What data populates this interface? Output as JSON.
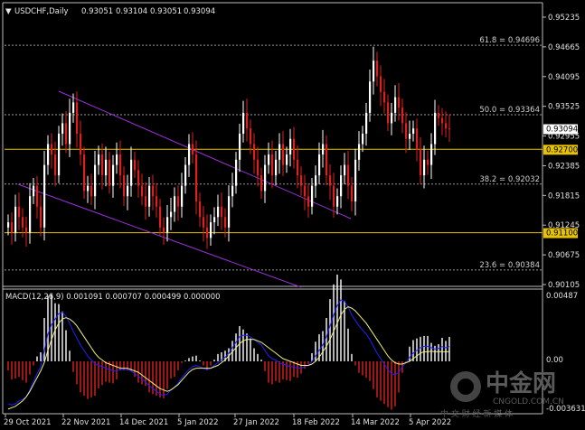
{
  "header": {
    "symbol_label": "USDCHF,Daily",
    "ohlc": [
      "0.93051",
      "0.93104",
      "0.93051",
      "0.93094"
    ]
  },
  "price_axis": {
    "ticks": [
      "0.95235",
      "0.94665",
      "0.94095",
      "0.93525",
      "0.92955",
      "0.92385",
      "0.91815",
      "0.91245",
      "0.90675",
      "0.90105"
    ],
    "current_price_tag": "0.93094",
    "hline_tags": [
      "0.92700",
      "0.91100"
    ]
  },
  "fibonacci": [
    {
      "label": "61.8 = 0.94696",
      "price": 0.94696
    },
    {
      "label": "50.0 = 0.93364",
      "price": 0.93364
    },
    {
      "label": "38.2 = 0.92032",
      "price": 0.92032
    },
    {
      "label": "23.6 = 0.90384",
      "price": 0.90384
    }
  ],
  "horizontal_lines": [
    {
      "price": 0.927,
      "color": "#e6c200"
    },
    {
      "price": 0.911,
      "color": "#e6c200"
    }
  ],
  "channel": {
    "color": "#9b30d9"
  },
  "macd": {
    "label": "MACD(12,26,9) 0.001091 0.000707 0.000499 0.000000",
    "ticks": [
      "0.00487",
      "0.00",
      "-0.003631"
    ]
  },
  "time_axis": {
    "labels": [
      "29 Oct 2021",
      "22 Nov 2021",
      "14 Dec 2021",
      "5 Jan 2022",
      "27 Jan 2022",
      "18 Feb 2022",
      "14 Mar 2022",
      "5 Apr 2022"
    ]
  },
  "watermark": {
    "brand": "中金网",
    "site": "CNGOLD.COM.CN",
    "tagline": "中 文 财 经 新 媒 体"
  },
  "colors": {
    "bull": "#ffffff",
    "bear": "#e02020",
    "macd_line": "#2020ff",
    "signal_line": "#f0f080",
    "hist_pos": "#ffffff",
    "hist_neg": "#e02020"
  },
  "chart_data": {
    "type": "candlestick",
    "closes": [
      0.913,
      0.911,
      0.916,
      0.914,
      0.912,
      0.911,
      0.918,
      0.92,
      0.916,
      0.912,
      0.924,
      0.928,
      0.926,
      0.922,
      0.93,
      0.932,
      0.928,
      0.934,
      0.936,
      0.93,
      0.926,
      0.919,
      0.92,
      0.918,
      0.924,
      0.926,
      0.922,
      0.925,
      0.92,
      0.924,
      0.926,
      0.922,
      0.918,
      0.92,
      0.925,
      0.923,
      0.92,
      0.918,
      0.916,
      0.92,
      0.918,
      0.916,
      0.912,
      0.911,
      0.914,
      0.915,
      0.918,
      0.916,
      0.92,
      0.924,
      0.928,
      0.926,
      0.917,
      0.914,
      0.912,
      0.91,
      0.913,
      0.914,
      0.916,
      0.914,
      0.912,
      0.918,
      0.92,
      0.925,
      0.93,
      0.934,
      0.931,
      0.928,
      0.925,
      0.922,
      0.919,
      0.924,
      0.926,
      0.922,
      0.925,
      0.928,
      0.924,
      0.926,
      0.929,
      0.925,
      0.922,
      0.92,
      0.918,
      0.916,
      0.92,
      0.922,
      0.926,
      0.928,
      0.922,
      0.92,
      0.916,
      0.918,
      0.922,
      0.924,
      0.92,
      0.917,
      0.925,
      0.928,
      0.93,
      0.934,
      0.94,
      0.944,
      0.941,
      0.938,
      0.936,
      0.932,
      0.934,
      0.937,
      0.935,
      0.932,
      0.929,
      0.93,
      0.931,
      0.927,
      0.922,
      0.925,
      0.924,
      0.928,
      0.934,
      0.933,
      0.932,
      0.931,
      0.93094
    ],
    "macd_values": [
      -0.0031,
      -0.0032,
      -0.0031,
      -0.0029,
      -0.0028,
      -0.0026,
      -0.0021,
      -0.0015,
      -0.0009,
      -0.0004,
      0.0008,
      0.002,
      0.0027,
      0.0031,
      0.0035,
      0.0036,
      0.0033,
      0.0028,
      0.0022,
      0.0017,
      0.0012,
      0.0008,
      0.0004,
      0.0001,
      -0.0002,
      -0.0003,
      -0.0004,
      -0.0005,
      -0.0006,
      -0.0007,
      -0.0007,
      -0.0006,
      -0.0006,
      -0.0006,
      -0.0007,
      -0.0009,
      -0.0011,
      -0.0013,
      -0.0015,
      -0.0018,
      -0.002,
      -0.0022,
      -0.0024,
      -0.0025,
      -0.0024,
      -0.0021,
      -0.0019,
      -0.0016,
      -0.0012,
      -0.0009,
      -0.0006,
      -0.0004,
      -0.0003,
      -0.0004,
      -0.0005,
      -0.0006,
      -0.0005,
      -0.0003,
      -0.0001,
      0.0001,
      0.0003,
      0.0006,
      0.001,
      0.0014,
      0.0018,
      0.0019,
      0.0019,
      0.0018,
      0.0016,
      0.0014,
      0.0012,
      0.0008,
      0.0004,
      0.0002,
      0.0001,
      -0.0001,
      -0.0002,
      -0.0003,
      -0.0004,
      -0.0004,
      -0.0005,
      -0.0005,
      -0.0004,
      -0.0003,
      0.0,
      0.0004,
      0.0008,
      0.0012,
      0.0018,
      0.0026,
      0.0034,
      0.0041,
      0.0045,
      0.0044,
      0.004,
      0.0034,
      0.003,
      0.0026,
      0.0023,
      0.002,
      0.0016,
      0.0011,
      0.0006,
      0.0002,
      -0.0002,
      -0.0006,
      -0.0009,
      -0.001,
      -0.0008,
      -0.0004,
      -0.0001,
      0.0003,
      0.0006,
      0.0008,
      0.001,
      0.0011,
      0.0011,
      0.001,
      0.0009,
      0.00095,
      0.00107,
      0.001,
      0.00109
    ],
    "signal_values": [
      -0.0035,
      -0.0034,
      -0.0033,
      -0.0031,
      -0.0029,
      -0.0026,
      -0.0022,
      -0.0017,
      -0.0012,
      -0.0007,
      -0.0001,
      0.0008,
      0.0016,
      0.0023,
      0.0028,
      0.0031,
      0.0032,
      0.0031,
      0.0029,
      0.0026,
      0.0022,
      0.0018,
      0.0014,
      0.001,
      0.0006,
      0.0003,
      0.0001,
      -0.0001,
      -0.0002,
      -0.0003,
      -0.0004,
      -0.0005,
      -0.0005,
      -0.0005,
      -0.0006,
      -0.0007,
      -0.0008,
      -0.001,
      -0.0012,
      -0.0014,
      -0.0016,
      -0.0018,
      -0.002,
      -0.0021,
      -0.0022,
      -0.0021,
      -0.0019,
      -0.0017,
      -0.0014,
      -0.0011,
      -0.0008,
      -0.0006,
      -0.0005,
      -0.0005,
      -0.0005,
      -0.0005,
      -0.0005,
      -0.0004,
      -0.0003,
      -0.0001,
      0.0001,
      0.0004,
      0.0007,
      0.001,
      0.0013,
      0.0015,
      0.0016,
      0.0016,
      0.0016,
      0.0015,
      0.0014,
      0.0012,
      0.001,
      0.0008,
      0.0006,
      0.0004,
      0.0002,
      0.0001,
      0.0,
      -0.0001,
      -0.0002,
      -0.0003,
      -0.0003,
      -0.0003,
      -0.0002,
      0.0,
      0.0003,
      0.0007,
      0.0011,
      0.0016,
      0.0022,
      0.0028,
      0.0034,
      0.0038,
      0.004,
      0.0039,
      0.0037,
      0.0034,
      0.0031,
      0.0028,
      0.0024,
      0.002,
      0.0016,
      0.0012,
      0.0008,
      0.0004,
      0.0001,
      -0.0001,
      -0.0002,
      -0.0002,
      -0.0001,
      0.0,
      0.0002,
      0.0004,
      0.0006,
      0.0007,
      0.0007,
      0.00075,
      0.0007,
      0.00072,
      0.00071,
      0.0007,
      0.00071
    ]
  }
}
